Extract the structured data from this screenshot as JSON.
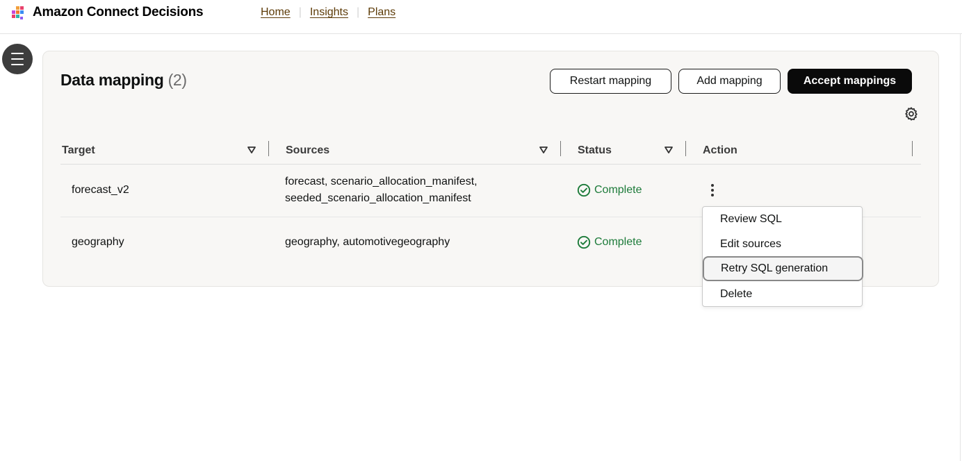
{
  "app": {
    "title": "Amazon Connect Decisions",
    "logo_icon": "amazon-connect-decisions-logo"
  },
  "nav": {
    "items": [
      {
        "label": "Home"
      },
      {
        "label": "Insights"
      },
      {
        "label": "Plans"
      }
    ]
  },
  "sidebar": {
    "menu_icon": "hamburger-menu-icon"
  },
  "panel": {
    "title": "Data mapping",
    "count": "(2)",
    "buttons": {
      "restart": "Restart mapping",
      "add": "Add mapping",
      "accept": "Accept mappings"
    },
    "settings_icon": "gear-icon"
  },
  "table": {
    "columns": [
      {
        "label": "Target",
        "sortable": true
      },
      {
        "label": "Sources",
        "sortable": true
      },
      {
        "label": "Status",
        "sortable": true
      },
      {
        "label": "Action",
        "sortable": false
      }
    ],
    "rows": [
      {
        "target": "forecast_v2",
        "sources_line1": "forecast, scenario_allocation_manifest,",
        "sources_line2": "seeded_scenario_allocation_manifest",
        "status": "Complete"
      },
      {
        "target": "geography",
        "sources_line1": "geography, automotivegeography",
        "sources_line2": "",
        "status": "Complete"
      }
    ]
  },
  "action_menu": {
    "items": [
      {
        "label": "Review SQL"
      },
      {
        "label": "Edit sources"
      },
      {
        "label": "Retry SQL generation"
      },
      {
        "label": "Delete"
      }
    ],
    "focused_item": "Retry SQL generation"
  },
  "colors": {
    "status_complete": "#1d7b3a",
    "nav_link": "#5c3a06",
    "primary_button": "#0a0a0a"
  }
}
